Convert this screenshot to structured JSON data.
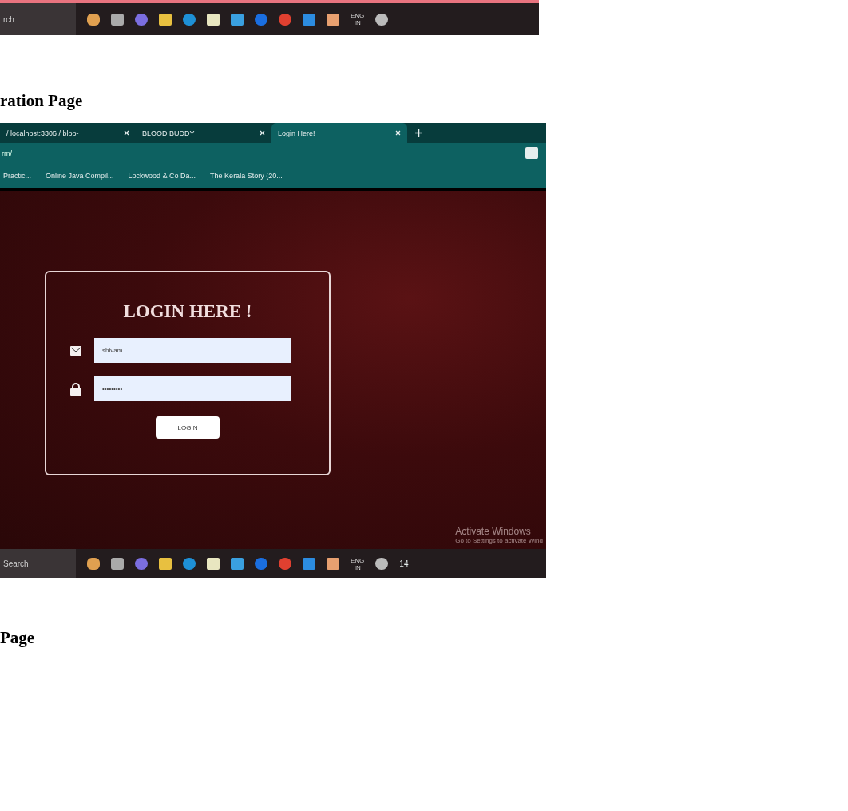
{
  "top_taskbar": {
    "search": "rch",
    "language": "ENG",
    "region": "IN"
  },
  "caption_top": "ration Page",
  "browser": {
    "tabs": [
      {
        "label": "/ localhost:3306 / bloo-",
        "selected": false
      },
      {
        "label": "BLOOD BUDDY",
        "selected": false
      },
      {
        "label": "Login Here!",
        "selected": true
      }
    ],
    "address": "rm/",
    "bookmarks": [
      "Practic...",
      "Online Java Compil...",
      "Lockwood & Co Da...",
      "The Kerala Story (20..."
    ],
    "login": {
      "title": "LOGIN HERE !",
      "username": "shivam",
      "password": "•••••••••",
      "button": "LOGIN"
    },
    "activation": {
      "title": "Activate Windows",
      "subtitle": "Go to Settings to activate Wind"
    },
    "taskbar": {
      "search": "Search",
      "language": "ENG",
      "region": "IN",
      "time": "14"
    }
  },
  "caption_bottom": "Page"
}
